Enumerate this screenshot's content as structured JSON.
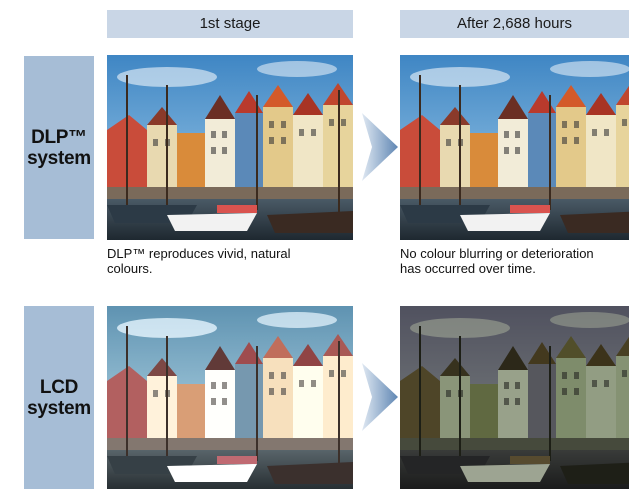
{
  "headers": [
    "1st stage",
    "After 2,688 hours"
  ],
  "rows": [
    {
      "label": "DLP™\nsystem",
      "caption_first": "DLP™ reproduces vivid, natural\ncolours.",
      "caption_after": "No colour blurring or deterioration\nhas occurred over time."
    },
    {
      "label": "LCD\nsystem"
    }
  ],
  "colors": {
    "header_bg": "#c9d6e6",
    "label_bg": "#a6bdd6",
    "arrow_light": "#dfe8f2",
    "arrow_dark": "#5f86b3"
  }
}
